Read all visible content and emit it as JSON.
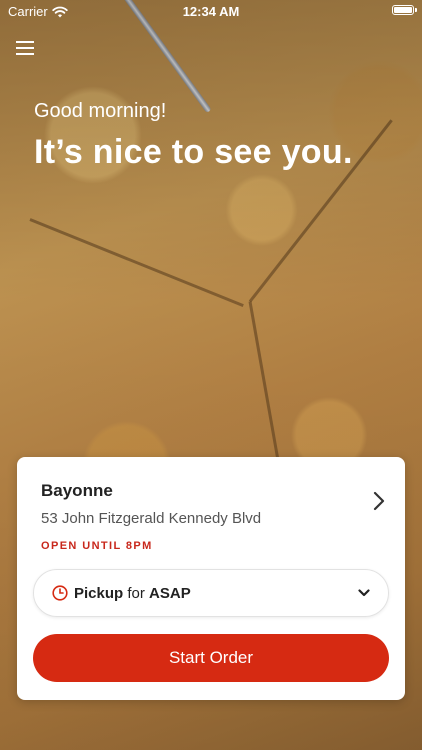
{
  "status_bar": {
    "carrier": "Carrier",
    "time": "12:34 AM"
  },
  "greeting": {
    "small": "Good morning!",
    "large": "It’s nice to see you."
  },
  "store": {
    "name": "Bayonne",
    "address": "53 John Fitzgerald Kennedy Blvd",
    "status": "OPEN UNTIL 8PM"
  },
  "order_mode": {
    "mode": "Pickup",
    "connector": "for",
    "time": "ASAP"
  },
  "start_button": {
    "label": "Start Order"
  },
  "icons": {
    "menu": "hamburger-menu-icon",
    "wifi": "wifi-icon",
    "battery": "battery-icon",
    "store_chevron": "chevron-right-icon",
    "clock": "clock-icon",
    "pickup_chevron": "chevron-down-icon"
  },
  "colors": {
    "accent": "#d62a12",
    "status_text": "#c8281c",
    "text": "#222222"
  }
}
